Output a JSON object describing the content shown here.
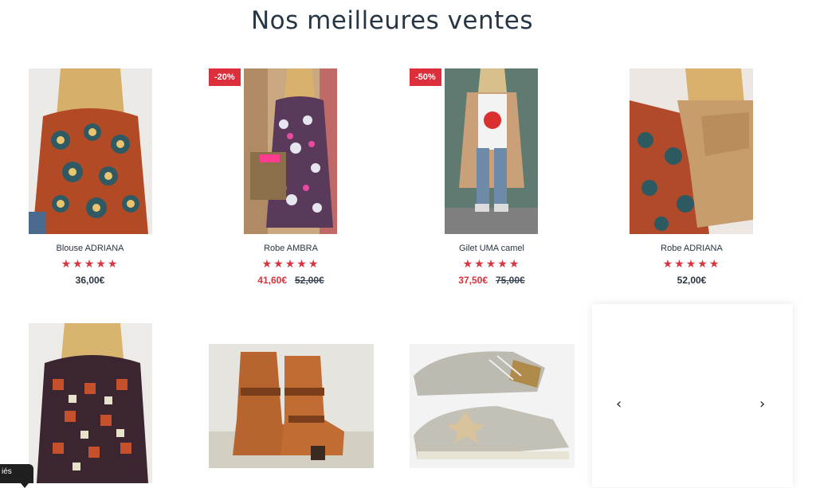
{
  "section": {
    "title": "Nos meilleures ventes"
  },
  "products": [
    {
      "name": "Blouse ADRIANA",
      "stars": "★★★★★",
      "price": "36,00€"
    },
    {
      "name": "Robe AMBRA",
      "stars": "★★★★★",
      "badge": "-20%",
      "price": "41,60€",
      "old_price": "52,00€"
    },
    {
      "name": "Gilet UMA camel",
      "stars": "★★★★★",
      "badge": "-50%",
      "price": "37,50€",
      "old_price": "75,00€"
    },
    {
      "name": "Robe ADRIANA",
      "stars": "★★★★★",
      "price": "52,00€"
    }
  ],
  "slider": {
    "prev": "‹",
    "next": "›"
  },
  "floating_tab": {
    "label": "iés"
  },
  "colors": {
    "accent": "#dc2f3b",
    "text": "#2a3542",
    "stars": "#d63642"
  }
}
